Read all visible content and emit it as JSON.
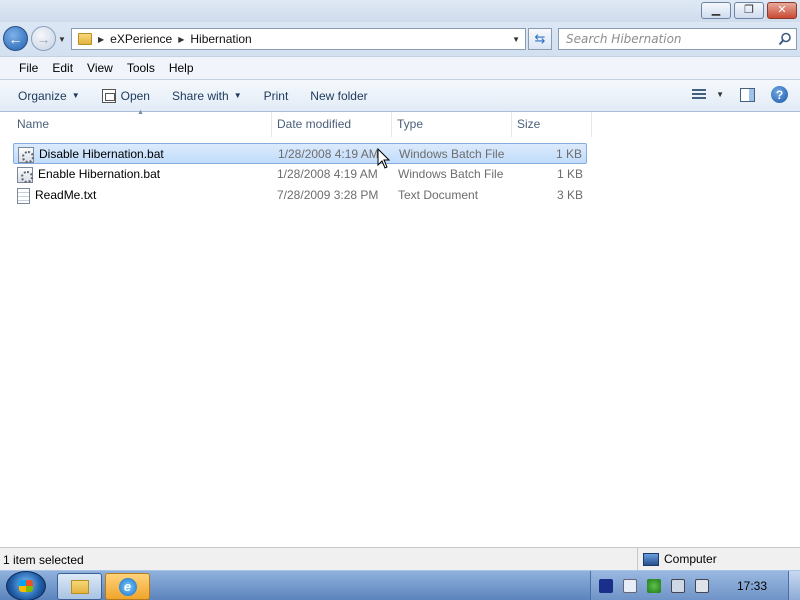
{
  "address": {
    "crumbs": [
      "eXPerience",
      "Hibernation"
    ],
    "search_placeholder": "Search Hibernation"
  },
  "menu": [
    "File",
    "Edit",
    "View",
    "Tools",
    "Help"
  ],
  "commands": {
    "organize": "Organize",
    "open": "Open",
    "share_with": "Share with",
    "print": "Print",
    "new_folder": "New folder"
  },
  "columns": {
    "name": "Name",
    "date": "Date modified",
    "type": "Type",
    "size": "Size"
  },
  "files": [
    {
      "name": "Disable Hibernation.bat",
      "date": "1/28/2008 4:19 AM",
      "type": "Windows Batch File",
      "size": "1 KB",
      "icon": "batch-file-icon",
      "selected": true
    },
    {
      "name": "Enable Hibernation.bat",
      "date": "1/28/2008 4:19 AM",
      "type": "Windows Batch File",
      "size": "1 KB",
      "icon": "batch-file-icon",
      "selected": false
    },
    {
      "name": "ReadMe.txt",
      "date": "7/28/2009 3:28 PM",
      "type": "Text Document",
      "size": "3 KB",
      "icon": "text-file-icon",
      "selected": false
    }
  ],
  "status": {
    "selection": "1 item selected",
    "location": "Computer"
  },
  "taskbar": {
    "clock": "17:33"
  },
  "colors": {
    "selection_bg": "#c9e0fb",
    "selection_border": "#84acdd",
    "taskbar": "#6f93c8"
  }
}
